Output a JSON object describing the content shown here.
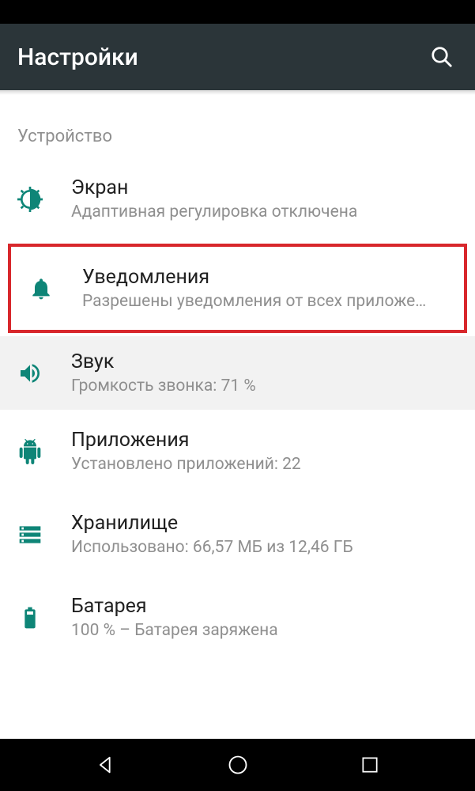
{
  "app_bar": {
    "title": "Настройки",
    "search_icon": "search"
  },
  "section": {
    "header": "Устройство"
  },
  "items": [
    {
      "icon": "display",
      "title": "Экран",
      "subtitle": "Адаптивная регулировка отключена"
    },
    {
      "icon": "notifications",
      "title": "Уведомления",
      "subtitle": "Разрешены уведомления от всех приложе…"
    },
    {
      "icon": "sound",
      "title": "Звук",
      "subtitle": "Громкость звонка: 71 %"
    },
    {
      "icon": "apps",
      "title": "Приложения",
      "subtitle": "Установлено приложений: 22"
    },
    {
      "icon": "storage",
      "title": "Хранилище",
      "subtitle": "Использовано: 66,57 МБ из 12,46 ГБ"
    },
    {
      "icon": "battery",
      "title": "Батарея",
      "subtitle": "100 % – Батарея заряжена"
    }
  ],
  "colors": {
    "accent": "#0e8577",
    "highlight_border": "#d8272c",
    "app_bar_bg": "#2b3539"
  }
}
